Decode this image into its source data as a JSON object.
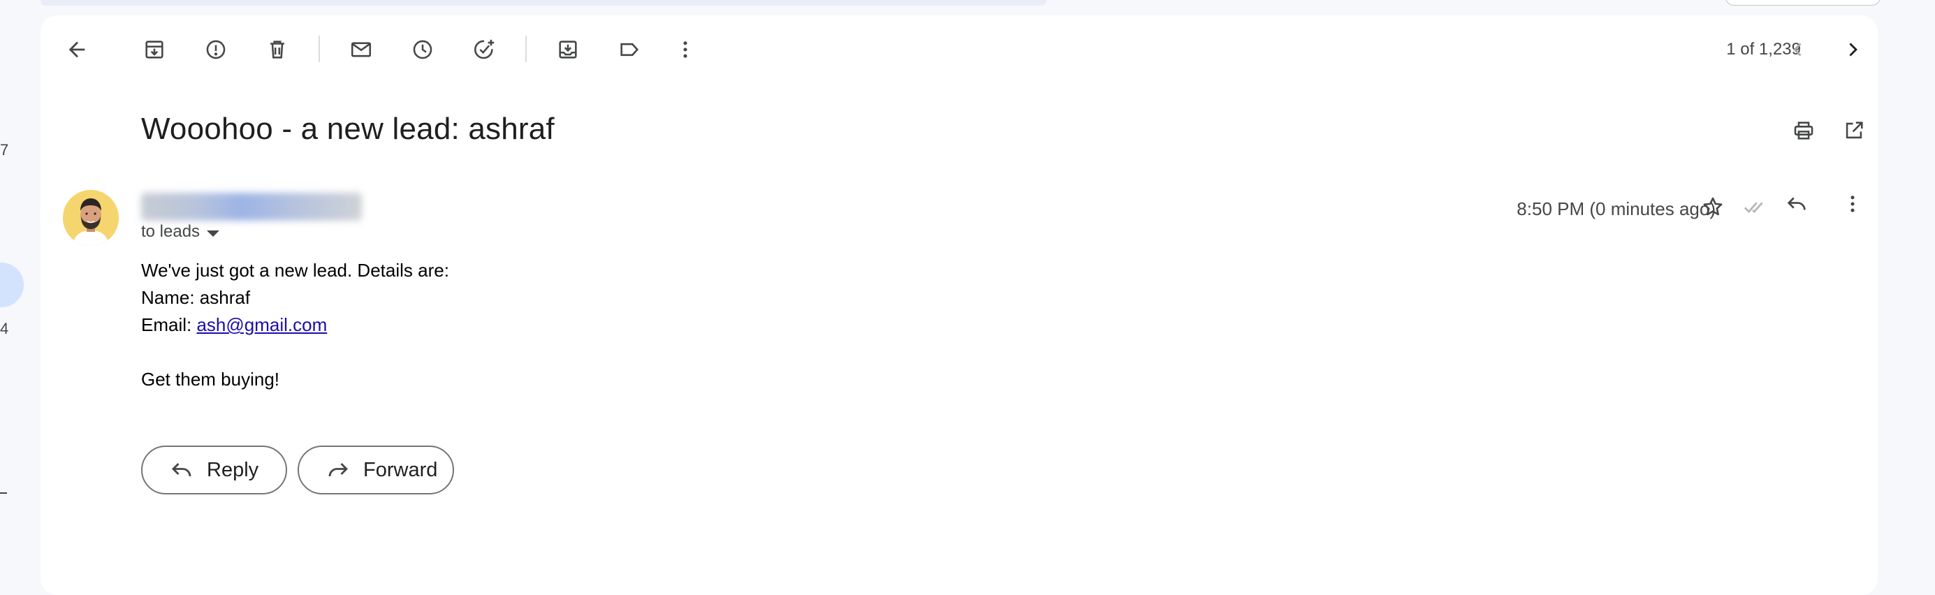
{
  "left_rail": {
    "counts": [
      "7",
      "4"
    ]
  },
  "toolbar": {
    "back": {
      "icon": "arrow-left-icon"
    },
    "archive": {
      "icon": "archive-icon"
    },
    "report_spam": {
      "icon": "report-spam-icon"
    },
    "delete": {
      "icon": "trash-icon"
    },
    "mark_unread": {
      "icon": "mail-icon"
    },
    "snooze": {
      "icon": "clock-icon"
    },
    "add_to_tasks": {
      "icon": "add-task-icon"
    },
    "move_to": {
      "icon": "move-to-inbox-icon"
    },
    "labels": {
      "icon": "label-icon"
    },
    "more": {
      "icon": "more-vert-icon"
    },
    "pager": "1 of 1,239",
    "older": {
      "icon": "chevron-left-icon"
    },
    "newer": {
      "icon": "chevron-right-icon"
    }
  },
  "message": {
    "subject": "Wooohoo - a new lead: ashraf",
    "print": {
      "icon": "print-icon"
    },
    "open_in_new": {
      "icon": "open-in-new-icon"
    },
    "to_line": "to leads",
    "timestamp": "8:50 PM (0 minutes ago)",
    "body": {
      "line1": "We've just got a new lead. Details are:",
      "line2": "Name: ashraf",
      "email_label": "Email: ",
      "email_link": "ash@gmail.com",
      "line4": "Get them buying!"
    },
    "reply_button": "Reply",
    "forward_button": "Forward"
  },
  "colors": {
    "background": "#f6f8fc",
    "card": "#ffffff",
    "link": "#1a0dab",
    "avatar_bg": "#f5d56e",
    "selected_nav": "#d3e3fd"
  }
}
